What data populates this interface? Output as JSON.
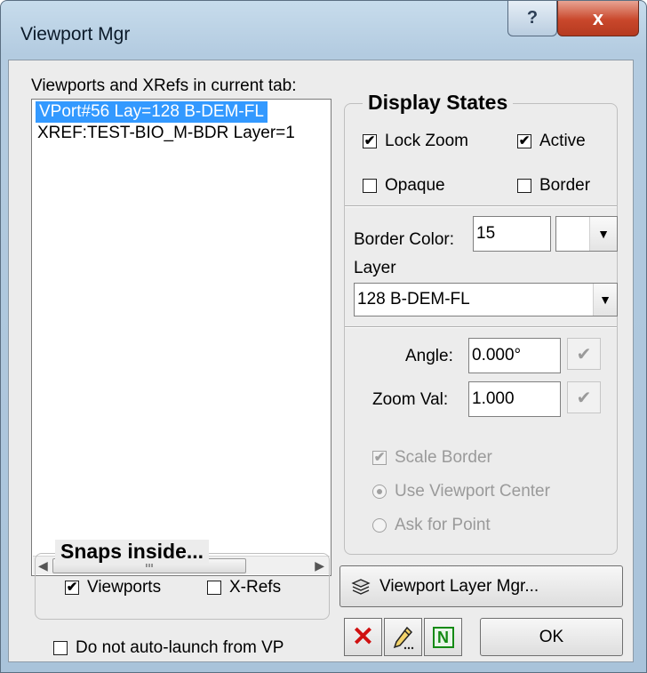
{
  "window": {
    "title": "Viewport Mgr",
    "help_label": "?",
    "close_label": "x"
  },
  "list": {
    "label": "Viewports and XRefs in current tab:",
    "items": [
      "VPort#56 Lay=128 B-DEM-FL",
      "XREF:TEST-BIO_M-BDR Layer=1"
    ],
    "scroll_thumb_grip": "III"
  },
  "display_states": {
    "title": "Display States",
    "lock_zoom": {
      "label": "Lock Zoom",
      "checked": "✔"
    },
    "active": {
      "label": "Active",
      "checked": "✔"
    },
    "opaque": {
      "label": "Opaque"
    },
    "border": {
      "label": "Border"
    },
    "border_color_label": "Border Color:",
    "border_color_value": "15",
    "layer_label": "Layer",
    "layer_value": "128 B-DEM-FL",
    "angle_label": "Angle:",
    "angle_value": "0.000°",
    "zoom_label": "Zoom Val:",
    "zoom_value": "1.000",
    "scale_border": {
      "label": "Scale Border",
      "checked": "✔"
    },
    "use_center_label": "Use Viewport Center",
    "ask_point_label": "Ask for Point"
  },
  "snaps": {
    "title": "Snaps inside...",
    "viewports": {
      "label": "Viewports",
      "checked": "✔"
    },
    "xrefs": {
      "label": "X-Refs"
    }
  },
  "no_auto_launch_label": "Do not auto-launch from VP",
  "buttons": {
    "layer_mgr": "Viewport Layer Mgr...",
    "ok": "OK",
    "new_icon_label": "N"
  },
  "colors": {
    "selection": "#3399ff",
    "delete_icon": "#d01010",
    "new_icon": "#138a13"
  }
}
